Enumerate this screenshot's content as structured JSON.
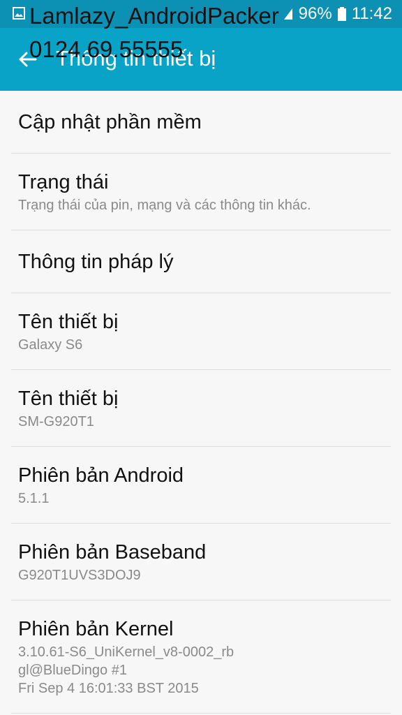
{
  "status_bar": {
    "battery": "96%",
    "time": "11:42",
    "icons": [
      "image-notification-icon",
      "signal-icon",
      "battery-icon"
    ]
  },
  "watermark": {
    "line1": "Lamlazy_AndroidPacker",
    "line2": "0124.69.55555"
  },
  "app_bar": {
    "title": "Thông tin thiết bị",
    "back_icon": "arrow-back-icon"
  },
  "items": [
    {
      "title": "Cập nhật phần mềm",
      "subtitle": ""
    },
    {
      "title": "Trạng thái",
      "subtitle": "Trạng thái của pin, mạng và các thông tin khác."
    },
    {
      "title": "Thông tin pháp lý",
      "subtitle": ""
    },
    {
      "title": "Tên thiết bị",
      "subtitle": "Galaxy S6"
    },
    {
      "title": "Tên thiết bị",
      "subtitle": "SM-G920T1"
    },
    {
      "title": "Phiên bản Android",
      "subtitle": "5.1.1"
    },
    {
      "title": "Phiên bản Baseband",
      "subtitle": "G920T1UVS3DOJ9"
    },
    {
      "title": "Phiên bản Kernel",
      "subtitle": "3.10.61-S6_UniKernel_v8-0002_rb\ngl@BlueDingo #1\nFri Sep 4 16:01:33 BST 2015"
    }
  ],
  "colors": {
    "status_bar": "#0c90b3",
    "app_bar": "#0aa3c8",
    "background": "#f7f7f7"
  }
}
